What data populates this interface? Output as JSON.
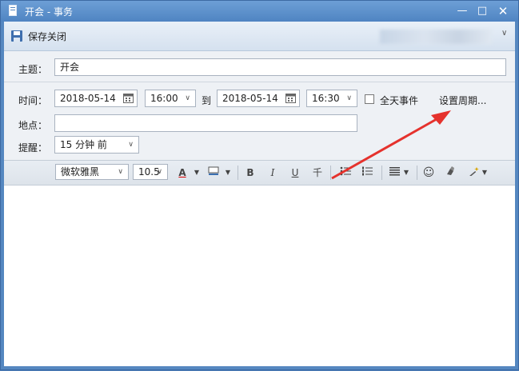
{
  "window": {
    "title": "开会 - 事务"
  },
  "toolbar": {
    "save_close_label": "保存关闭"
  },
  "form": {
    "subject_label": "主题：",
    "subject_value": "开会",
    "time_label": "时间：",
    "start_date": "2018-05-14",
    "start_time": "16:00",
    "to_label": "到",
    "end_date": "2018-05-14",
    "end_time": "16:30",
    "all_day_label": "全天事件",
    "recurrence_link": "设置周期...",
    "location_label": "地点：",
    "location_value": "",
    "reminder_label": "提醒：",
    "reminder_value": "15 分钟 前"
  },
  "format_bar": {
    "font_name": "微软雅黑",
    "font_size": "10.5",
    "bold": "B",
    "italic": "I",
    "underline": "U",
    "strikethrough": "千"
  },
  "colors": {
    "title_bar": "#5587c0",
    "arrow": "#e5322d"
  }
}
